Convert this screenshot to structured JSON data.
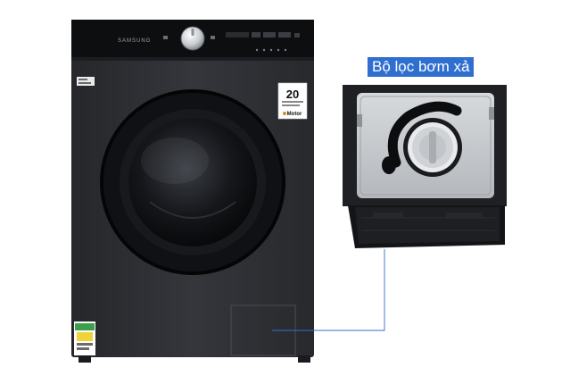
{
  "product": {
    "brand": "SAMSUNG",
    "warranty_years": "20",
    "warranty_motor_text": "Motor"
  },
  "callout": {
    "label": "Bộ lọc bơm xả"
  },
  "colors": {
    "body_dark": "#2e3034",
    "panel_black": "#0d0e10",
    "callout_blue": "#2f6fcf",
    "energy_label_green": "#3aa14a"
  }
}
